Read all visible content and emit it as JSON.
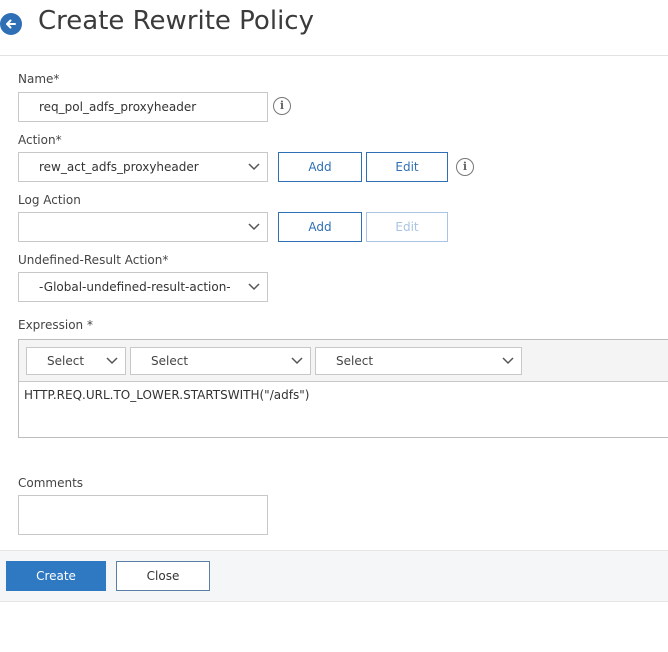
{
  "header": {
    "title": "Create Rewrite Policy",
    "back_icon": "back-arrow-icon"
  },
  "form": {
    "name": {
      "label": "Name*",
      "value": "req_pol_adfs_proxyheader"
    },
    "action": {
      "label": "Action*",
      "value": "rew_act_adfs_proxyheader",
      "add_label": "Add",
      "edit_label": "Edit"
    },
    "log_action": {
      "label": "Log Action",
      "value": "",
      "add_label": "Add",
      "edit_label": "Edit"
    },
    "undefined_result_action": {
      "label": "Undefined-Result Action*",
      "value": "-Global-undefined-result-action-"
    },
    "expression": {
      "label": "Expression",
      "required_mark": "*",
      "selects": [
        "Select",
        "Select",
        "Select"
      ],
      "value": "HTTP.REQ.URL.TO_LOWER.STARTSWITH(\"/adfs\")"
    },
    "comments": {
      "label": "Comments",
      "value": ""
    }
  },
  "footer": {
    "create_label": "Create",
    "close_label": "Close"
  },
  "colors": {
    "accent": "#2f78c2",
    "border": "#c8c8c8",
    "disabled": "#a9c5e5"
  }
}
